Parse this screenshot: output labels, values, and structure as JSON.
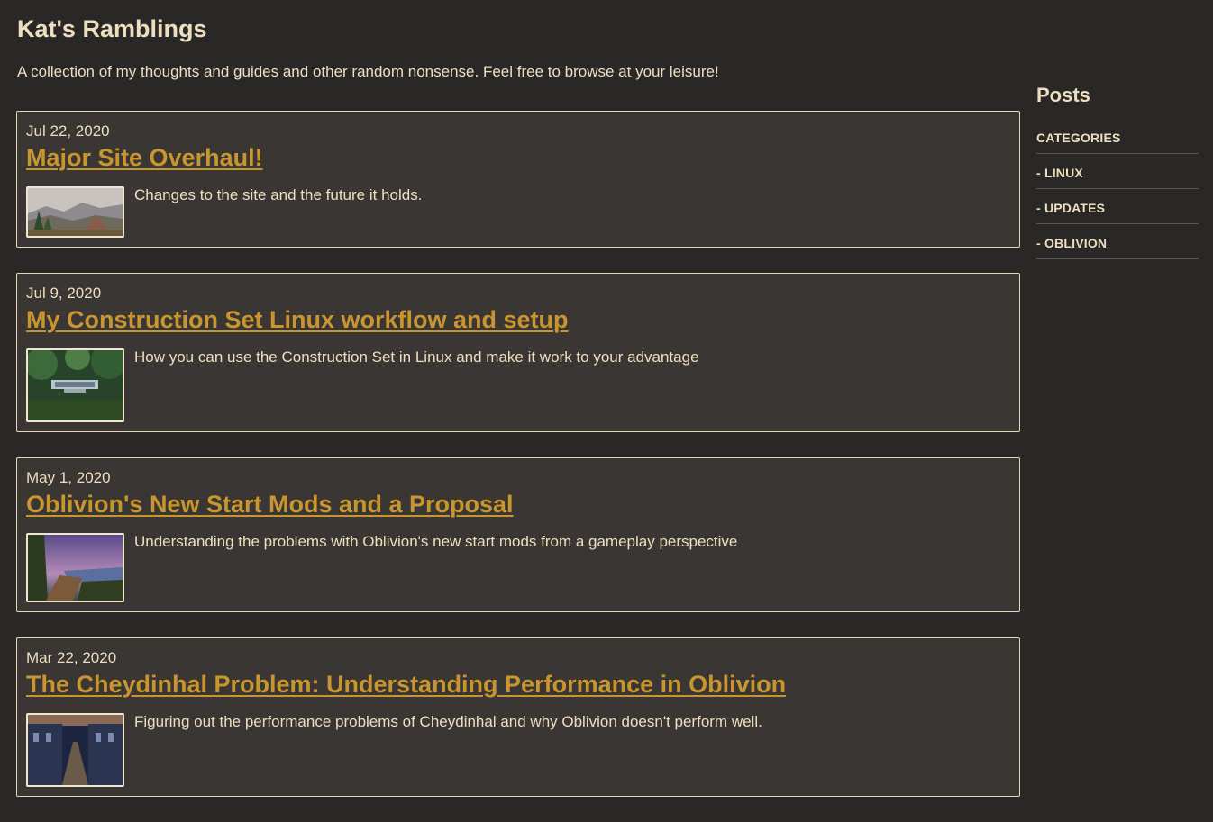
{
  "site": {
    "title": "Kat's Ramblings",
    "tagline": "A collection of my thoughts and guides and other random nonsense. Feel free to browse at your leisure!"
  },
  "posts": [
    {
      "date": "Jul 22, 2020",
      "title": "Major Site Overhaul!",
      "excerpt": "Changes to the site and the future it holds.",
      "thumbnail": "misty-mountain-landscape"
    },
    {
      "date": "Jul 9, 2020",
      "title": "My Construction Set Linux workflow and setup",
      "excerpt": "How you can use the Construction Set in Linux and make it work to your advantage",
      "thumbnail": "forest-sign-screenshot"
    },
    {
      "date": "May 1, 2020",
      "title": "Oblivion's New Start Mods and a Proposal",
      "excerpt": "Understanding the problems with Oblivion's new start mods from a gameplay perspective",
      "thumbnail": "purple-sky-river-path"
    },
    {
      "date": "Mar 22, 2020",
      "title": "The Cheydinhal Problem: Understanding Performance in Oblivion",
      "excerpt": "Figuring out the performance problems of Cheydinhal and why Oblivion doesn't perform well.",
      "thumbnail": "cheydinhal-street"
    }
  ],
  "sidebar": {
    "title": "Posts",
    "items": [
      {
        "label": "CATEGORIES"
      },
      {
        "label": "- LINUX"
      },
      {
        "label": "- UPDATES"
      },
      {
        "label": "- OBLIVION"
      }
    ]
  },
  "colors": {
    "background": "#292827",
    "card": "#3a3633",
    "text": "#eedec0",
    "link": "#c9952f"
  }
}
